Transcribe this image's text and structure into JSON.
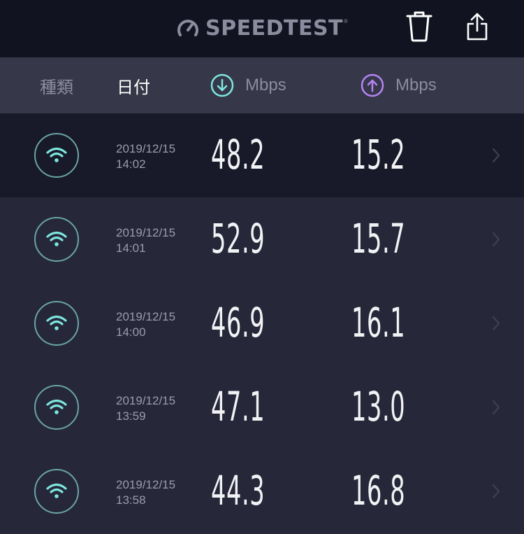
{
  "header": {
    "logo_text": "SPEEDTEST",
    "logo_tm": "®",
    "icons": [
      "trash-icon",
      "share-icon"
    ]
  },
  "columns": {
    "type": "種類",
    "date": "日付",
    "download_unit": "Mbps",
    "upload_unit": "Mbps"
  },
  "colors": {
    "download_accent": "#7de6e0",
    "upload_accent": "#b584f5",
    "selected_row": "#181a29"
  },
  "results": [
    {
      "date": "2019/12/15",
      "time": "14:02",
      "download": "48.2",
      "upload": "15.2",
      "connection_icon": "wifi-icon",
      "selected": true
    },
    {
      "date": "2019/12/15",
      "time": "14:01",
      "download": "52.9",
      "upload": "15.7",
      "connection_icon": "wifi-icon",
      "selected": false
    },
    {
      "date": "2019/12/15",
      "time": "14:00",
      "download": "46.9",
      "upload": "16.1",
      "connection_icon": "wifi-icon",
      "selected": false
    },
    {
      "date": "2019/12/15",
      "time": "13:59",
      "download": "47.1",
      "upload": "13.0",
      "connection_icon": "wifi-icon",
      "selected": false
    },
    {
      "date": "2019/12/15",
      "time": "13:58",
      "download": "44.3",
      "upload": "16.8",
      "connection_icon": "wifi-icon",
      "selected": false
    }
  ]
}
